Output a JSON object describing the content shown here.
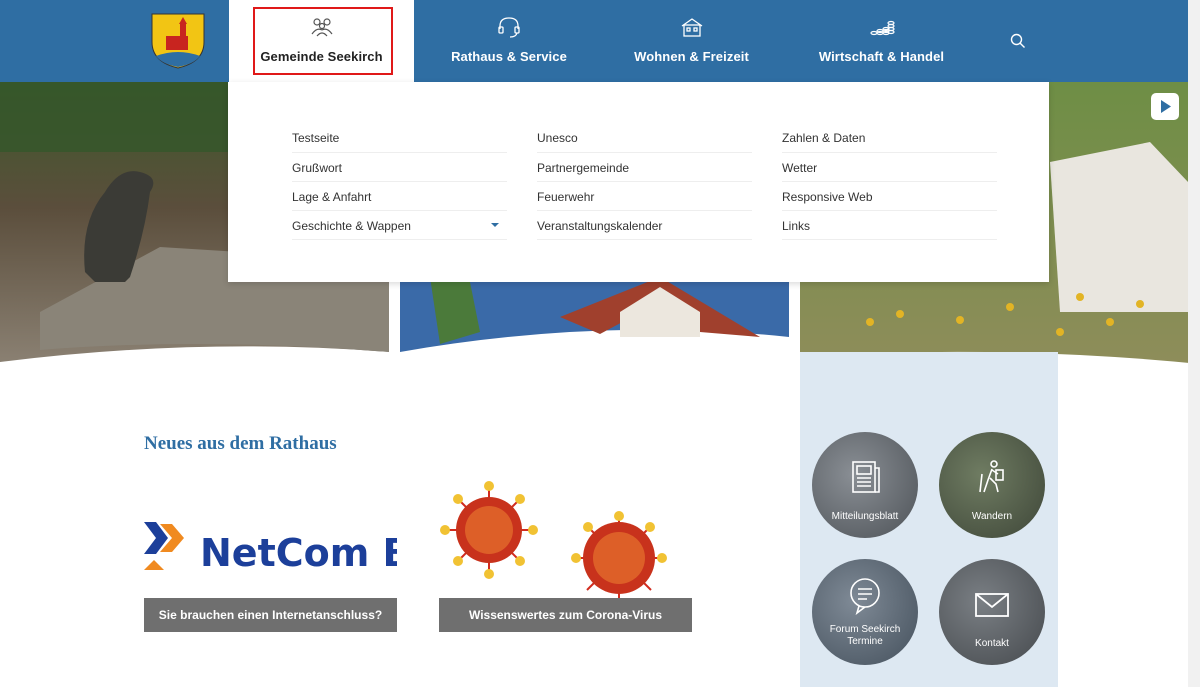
{
  "nav": {
    "items": [
      {
        "label": "Gemeinde Seekirch",
        "icon": "people-icon"
      },
      {
        "label": "Rathaus & Service",
        "icon": "headset-icon"
      },
      {
        "label": "Wohnen & Freizeit",
        "icon": "house-icon"
      },
      {
        "label": "Wirtschaft & Handel",
        "icon": "coins-icon"
      }
    ],
    "search_icon": "search-icon",
    "colors": {
      "bar": "#2f6ea3",
      "focus": "#e01919"
    }
  },
  "dropdown": {
    "col1": [
      "Testseite",
      "Grußwort",
      "Lage & Anfahrt",
      "Geschichte & Wappen"
    ],
    "col2": [
      "Unesco",
      "Partnergemeinde",
      "Feuerwehr",
      "Veranstaltungskalender"
    ],
    "col3": [
      "Zahlen & Daten",
      "Wetter",
      "Responsive Web",
      "Links"
    ]
  },
  "news": {
    "title": "Neues aus dem Rathaus",
    "cards": [
      {
        "image_text": "NetCom BV",
        "caption": "Sie brauchen einen Internetanschluss?"
      },
      {
        "caption": "Wissenswertes zum Corona-Virus"
      }
    ]
  },
  "tiles": [
    {
      "label": "Mitteilungsblatt",
      "icon": "newspaper-icon"
    },
    {
      "label": "Wandern",
      "icon": "hiker-icon"
    },
    {
      "label_line1": "Forum Seekirch",
      "label_line2": "Termine",
      "icon": "chat-bubble-icon"
    },
    {
      "label": "Kontakt",
      "icon": "mail-icon"
    }
  ]
}
